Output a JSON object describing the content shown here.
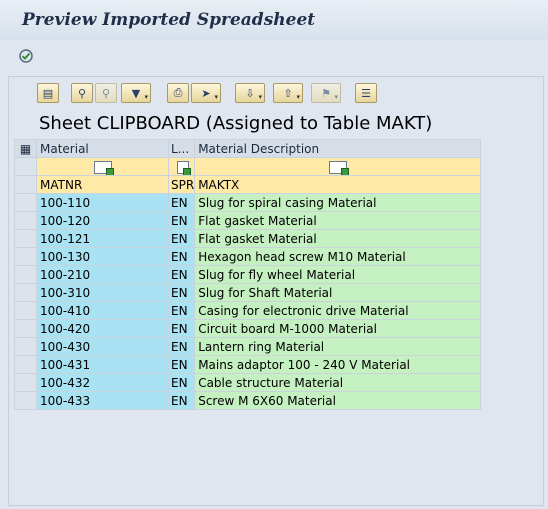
{
  "window": {
    "title": "Preview Imported Spreadsheet"
  },
  "app_toolbar": {
    "execute_icon": "execute-icon"
  },
  "toolbar": {
    "buttons": [
      {
        "name": "details-icon"
      },
      {
        "name": "find-icon"
      },
      {
        "name": "find-next-icon"
      },
      {
        "name": "filter-icon"
      },
      {
        "name": "print-icon"
      },
      {
        "name": "export-icon"
      },
      {
        "name": "sort-ascending-icon"
      },
      {
        "name": "sort-descending-icon"
      },
      {
        "name": "flag-icon"
      },
      {
        "name": "layout-icon"
      }
    ]
  },
  "sheet": {
    "title": "Sheet CLIPBOARD (Assigned to Table MAKT)",
    "columns": [
      {
        "header": "Material",
        "tech": "MATNR"
      },
      {
        "header": "L...",
        "tech": "SPR"
      },
      {
        "header": "Material Description",
        "tech": "MAKTX"
      }
    ],
    "rows": [
      [
        "100-110",
        "EN",
        "Slug for spiral casing Material"
      ],
      [
        "100-120",
        "EN",
        "Flat gasket Material"
      ],
      [
        "100-121",
        "EN",
        "Flat gasket Material"
      ],
      [
        "100-130",
        "EN",
        "Hexagon head screw M10 Material"
      ],
      [
        "100-210",
        "EN",
        "Slug for fly wheel Material"
      ],
      [
        "100-310",
        "EN",
        "Slug for Shaft Material"
      ],
      [
        "100-410",
        "EN",
        "Casing for electronic drive Material"
      ],
      [
        "100-420",
        "EN",
        "Circuit board M-1000 Material"
      ],
      [
        "100-430",
        "EN",
        "Lantern ring Material"
      ],
      [
        "100-431",
        "EN",
        "Mains adaptor 100 - 240 V Material"
      ],
      [
        "100-432",
        "EN",
        "Cable structure Material"
      ],
      [
        "100-433",
        "EN",
        "Screw M 6X60 Material"
      ]
    ]
  }
}
